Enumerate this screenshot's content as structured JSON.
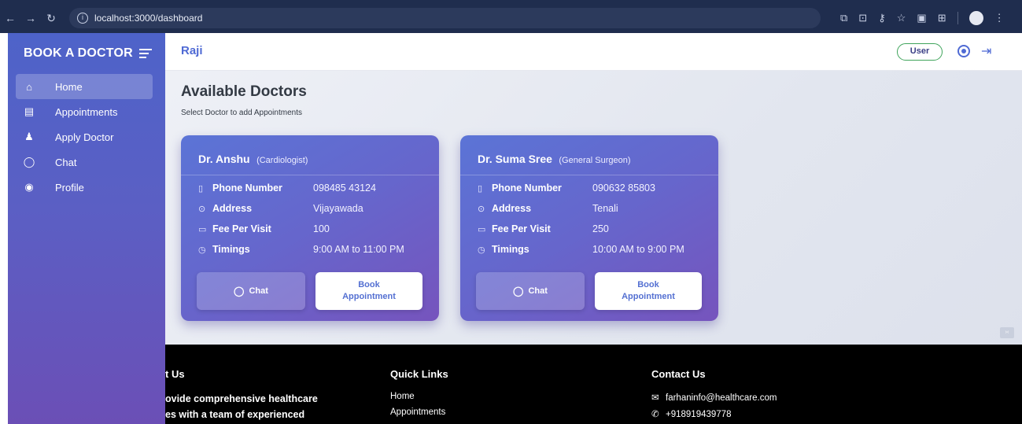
{
  "browser": {
    "url": "localhost:3000/dashboard"
  },
  "sidebar": {
    "brand": "BOOK A DOCTOR",
    "items": [
      {
        "label": "Home",
        "icon": "home-icon",
        "active": true
      },
      {
        "label": "Appointments",
        "icon": "file-icon",
        "active": false
      },
      {
        "label": "Apply Doctor",
        "icon": "doctor-icon",
        "active": false
      },
      {
        "label": "Chat",
        "icon": "chat-icon",
        "active": false
      },
      {
        "label": "Profile",
        "icon": "profile-icon",
        "active": false
      }
    ]
  },
  "header": {
    "user_name": "Raji",
    "role": "User"
  },
  "main": {
    "title": "Available Doctors",
    "subtitle": "Select Doctor to add Appointments"
  },
  "fields": {
    "phone": "Phone Number",
    "address": "Address",
    "fee": "Fee Per Visit",
    "timings": "Timings"
  },
  "doctors": [
    {
      "name": "Dr. Anshu",
      "specialty": "(Cardiologist)",
      "phone": "098485 43124",
      "address": "Vijayawada",
      "fee": "100",
      "timings": "9:00 AM to 11:00 PM",
      "chat_label": "Chat",
      "book_label_1": "Book",
      "book_label_2": "Appointment"
    },
    {
      "name": "Dr. Suma Sree",
      "specialty": "(General Surgeon)",
      "phone": "090632 85803",
      "address": "Tenali",
      "fee": "250",
      "timings": "10:00 AM to 9:00 PM",
      "chat_label": "Chat",
      "book_label_1": "Book",
      "book_label_2": "Appointment"
    }
  ],
  "footer": {
    "about_heading": "t Us",
    "about_line1": "ovide comprehensive healthcare",
    "about_line2": "es with a team of experienced",
    "links_heading": "Quick Links",
    "links": [
      "Home",
      "Appointments"
    ],
    "contact_heading": "Contact Us",
    "email": "farhaninfo@healthcare.com",
    "phone": "+918919439778"
  },
  "colors": {
    "accent": "#4f6ad4",
    "card_start": "#5b74d6",
    "card_end": "#7654bd",
    "role_border": "#3fa45b"
  }
}
